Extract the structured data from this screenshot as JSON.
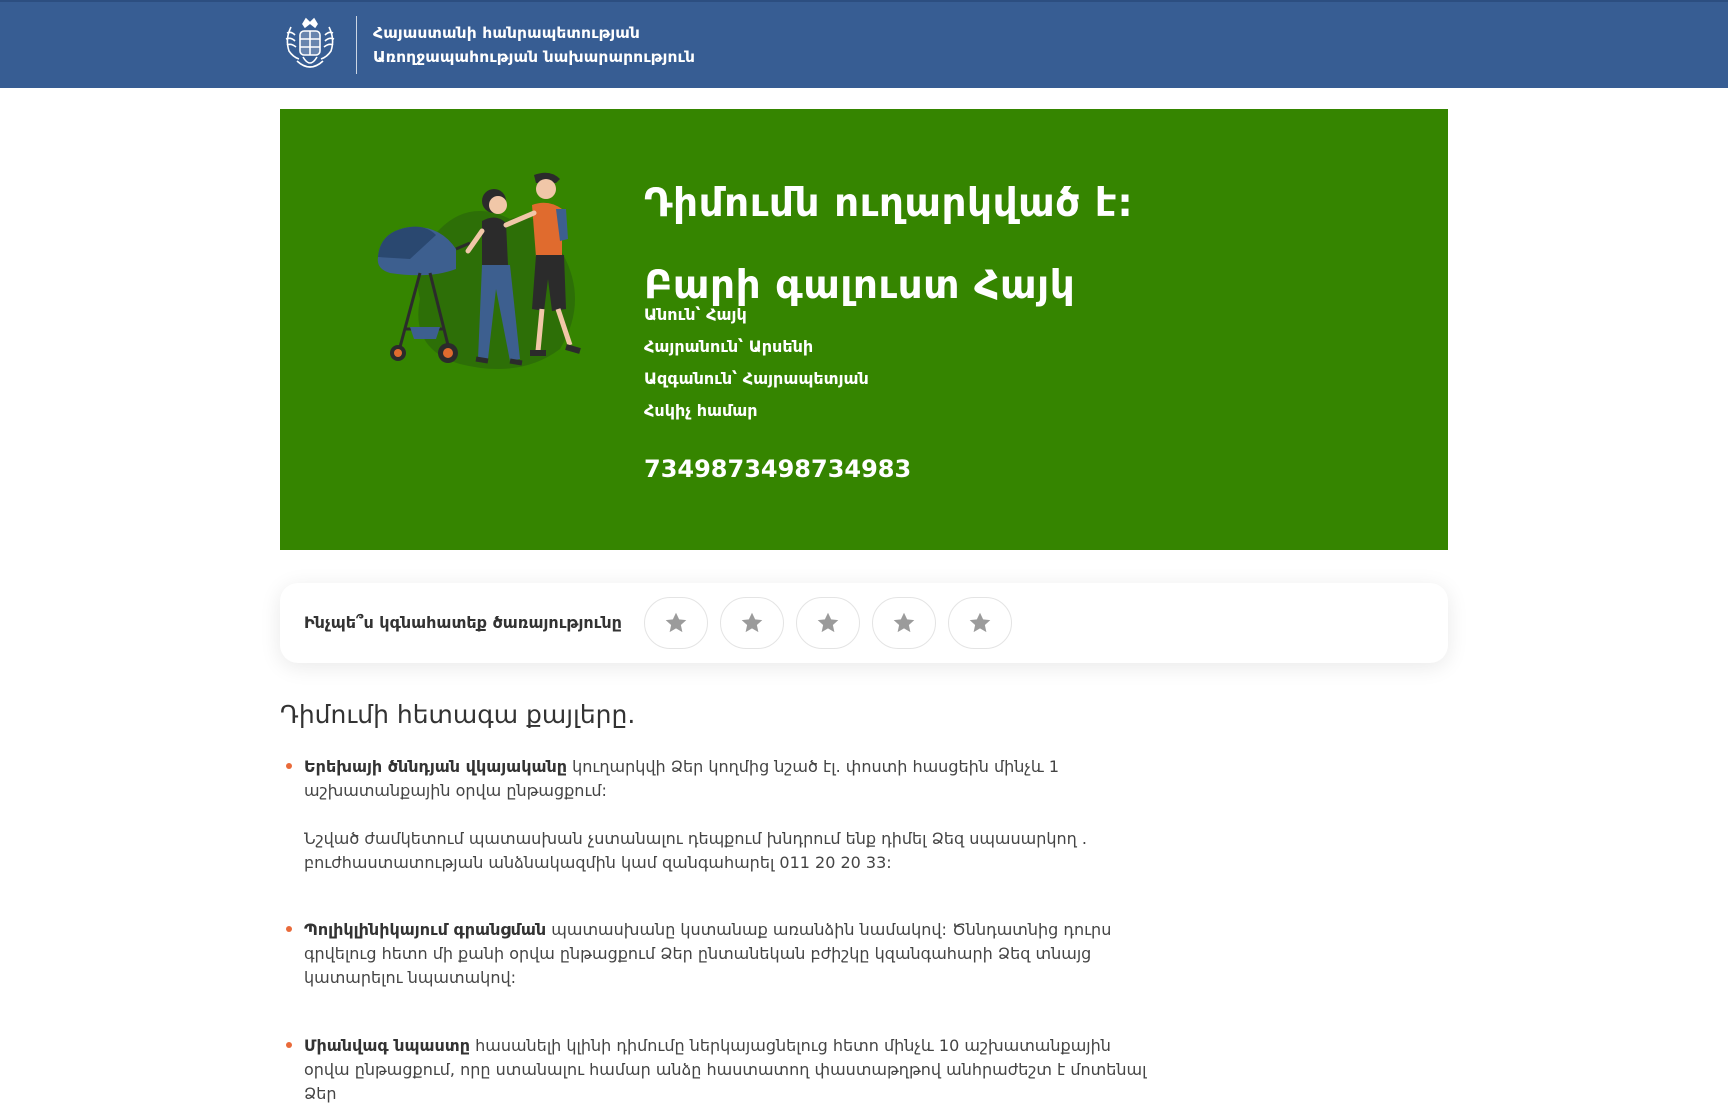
{
  "header": {
    "line1": "Հայաստանի հանրապետության",
    "line2": "Առողջապահության նախարարություն"
  },
  "banner": {
    "title": "Դիմումն ուղարկված է:",
    "greeting": "Բարի գալուստ Հայկ",
    "first_name": "Անուն՝ Հայկ",
    "patronymic": "Հայրանուն՝ Արսենի",
    "last_name": "Ազգանուն՝ Հայրապետյան",
    "tracking_label": "Հսկիչ համար",
    "tracking_number": "7349873498734983",
    "background_color": "#358500"
  },
  "rating": {
    "label": "Ինչպե՞ս կգնահատեք ծառայությունը",
    "max_stars": 5,
    "selected": 0
  },
  "steps": {
    "heading": "Դիմումի հետագա քայլերը.",
    "items": [
      {
        "bold": "Երեխայի ծննդյան վկայականը",
        "text": " կուղարկվի Ձեր կողմից նշած էլ. փոստի հասցեին մինչև 1 աշխատանքային օրվա ընթացքում:",
        "extra": "Նշված ժամկետում պատասխան չստանալու դեպքում խնդրում ենք դիմել Ձեզ սպասարկող . բուժհաստատության անձնակազմին կամ զանգահարել 011 20 20 33:"
      },
      {
        "bold": "Պոլիկլինիկայում գրանցման",
        "text": " պատասխանը կստանաք առանձին նամակով: Ծննդատնից դուրս գրվելուց հետո մի քանի օրվա ընթացքում Ձեր ընտանեկան բժիշկը կզանգահարի Ձեզ տնայց կատարելու նպատակով:"
      },
      {
        "bold": "Միանվագ նպաստը",
        "text": " հասանելի կլինի դիմումը ներկայացնելուց հետո մինչև 10 աշխատանքային օրվա ընթացքում, որը ստանալու համար անձը հաստատող փաստաթղթով անհրաժեշտ է մոտենալ Ձեր"
      }
    ]
  }
}
